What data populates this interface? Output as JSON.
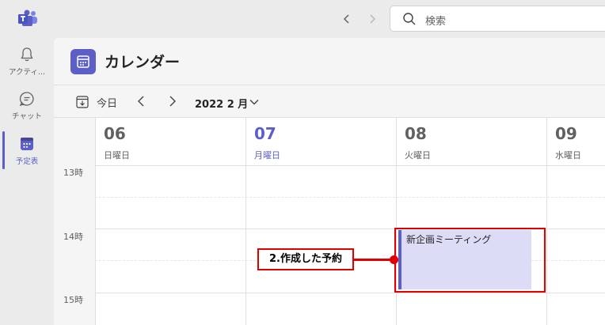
{
  "titlebar": {
    "search_placeholder": "検索"
  },
  "rail": {
    "items": [
      {
        "label": "アクティ...",
        "icon": "bell-icon"
      },
      {
        "label": "チャット",
        "icon": "chat-icon"
      },
      {
        "label": "予定表",
        "icon": "calendar-icon"
      }
    ],
    "active_index": 2
  },
  "app": {
    "title": "カレンダー"
  },
  "toolbar": {
    "today_label": "今日",
    "month_label": "2022 2 月"
  },
  "days": [
    {
      "num": "06",
      "name": "日曜日",
      "today": false
    },
    {
      "num": "07",
      "name": "月曜日",
      "today": true
    },
    {
      "num": "08",
      "name": "火曜日",
      "today": false
    },
    {
      "num": "09",
      "name": "水曜日",
      "today": false
    }
  ],
  "times": [
    "13時",
    "14時",
    "15時"
  ],
  "event": {
    "title": "新企画ミーティング"
  },
  "annotation": {
    "label": "2.作成した予約"
  },
  "colors": {
    "accent": "#5b5fc7",
    "event_fill": "#dcdcf7",
    "annotation_red": "#e00000"
  }
}
